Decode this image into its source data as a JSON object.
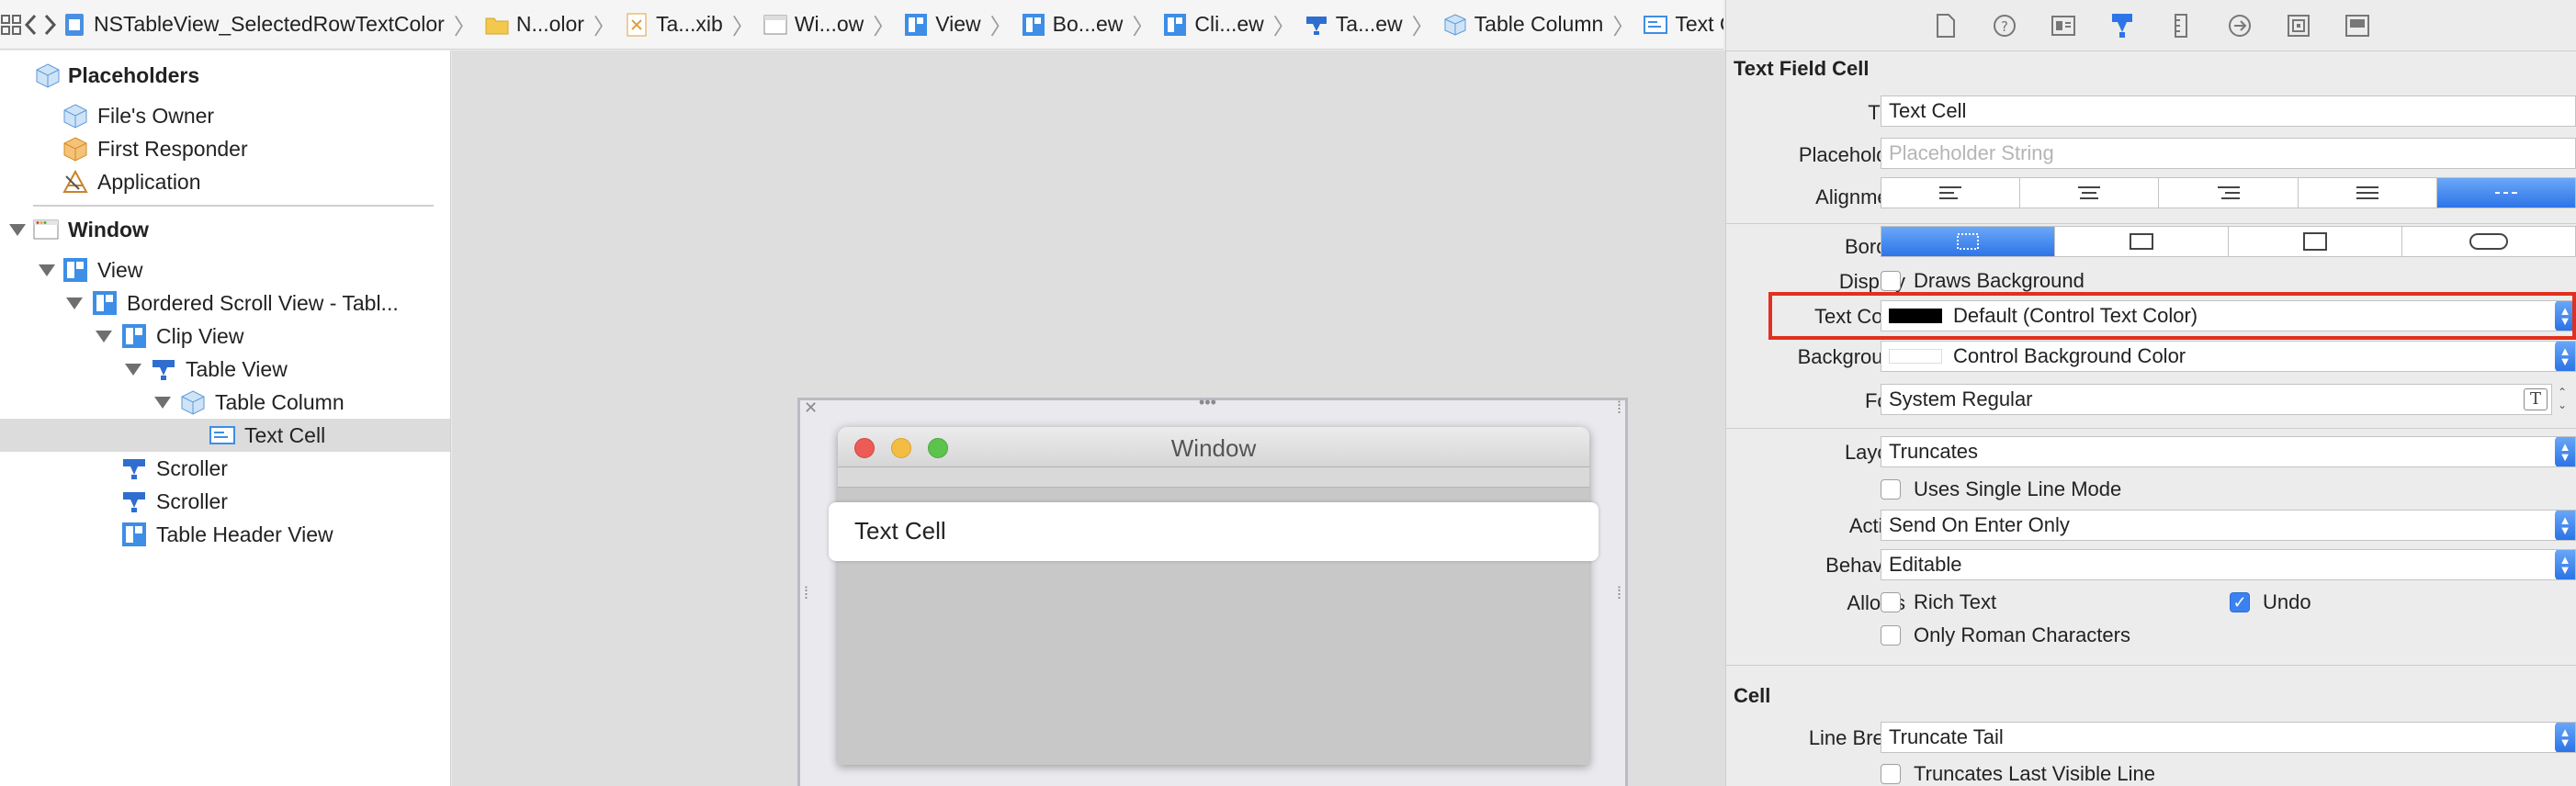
{
  "jumpbar": {
    "crumbs": [
      {
        "label": "NSTableView_SelectedRowTextColor",
        "icon": "project-file-icon"
      },
      {
        "label": "N...olor",
        "icon": "folder-icon"
      },
      {
        "label": "Ta...xib",
        "icon": "xib-file-icon"
      },
      {
        "label": "Wi...ow",
        "icon": "window-icon"
      },
      {
        "label": "View",
        "icon": "view-icon"
      },
      {
        "label": "Bo...ew",
        "icon": "view-icon"
      },
      {
        "label": "Cli...ew",
        "icon": "view-icon"
      },
      {
        "label": "Ta...ew",
        "icon": "tableview-icon"
      },
      {
        "label": "Table Column",
        "icon": "cube-icon"
      },
      {
        "label": "Text Cell",
        "icon": "textcell-icon"
      }
    ]
  },
  "outline": {
    "placeholders_header": "Placeholders",
    "files_owner": "File's Owner",
    "first_responder": "First Responder",
    "application": "Application",
    "window": "Window",
    "view": "View",
    "bordered_scroll_view": "Bordered Scroll View - Tabl...",
    "clip_view": "Clip View",
    "table_view": "Table View",
    "table_column": "Table Column",
    "text_cell": "Text Cell",
    "scroller1": "Scroller",
    "scroller2": "Scroller",
    "table_header_view": "Table Header View"
  },
  "canvas": {
    "window_title": "Window",
    "cell_text": "Text Cell"
  },
  "inspector": {
    "section_text_field_cell": "Text Field Cell",
    "title_label": "Title",
    "title_value": "Text Cell",
    "placeholder_label": "Placeholder",
    "placeholder_hint": "Placeholder String",
    "alignment_label": "Alignment",
    "border_label": "Border",
    "display_label": "Display",
    "draws_background": "Draws Background",
    "text_color_label": "Text Color",
    "text_color_value": "Default (Control Text Color)",
    "background_label": "Background",
    "background_value": "Control Background Color",
    "font_label": "Font",
    "font_value": "System Regular",
    "layout_label": "Layout",
    "layout_value": "Truncates",
    "uses_single_line": "Uses Single Line Mode",
    "action_label": "Action",
    "action_value": "Send On Enter Only",
    "behavior_label": "Behavior",
    "behavior_value": "Editable",
    "allows_label": "Allows",
    "rich_text": "Rich Text",
    "undo": "Undo",
    "only_roman": "Only Roman Characters",
    "section_cell": "Cell",
    "line_break_label": "Line Break",
    "line_break_value": "Truncate Tail",
    "truncates_last": "Truncates Last Visible Line"
  },
  "colors": {
    "accent": "#2d74e8",
    "highlight": "#e0301f",
    "text_color_swatch": "#000000",
    "background_swatch": "#ffffff"
  }
}
